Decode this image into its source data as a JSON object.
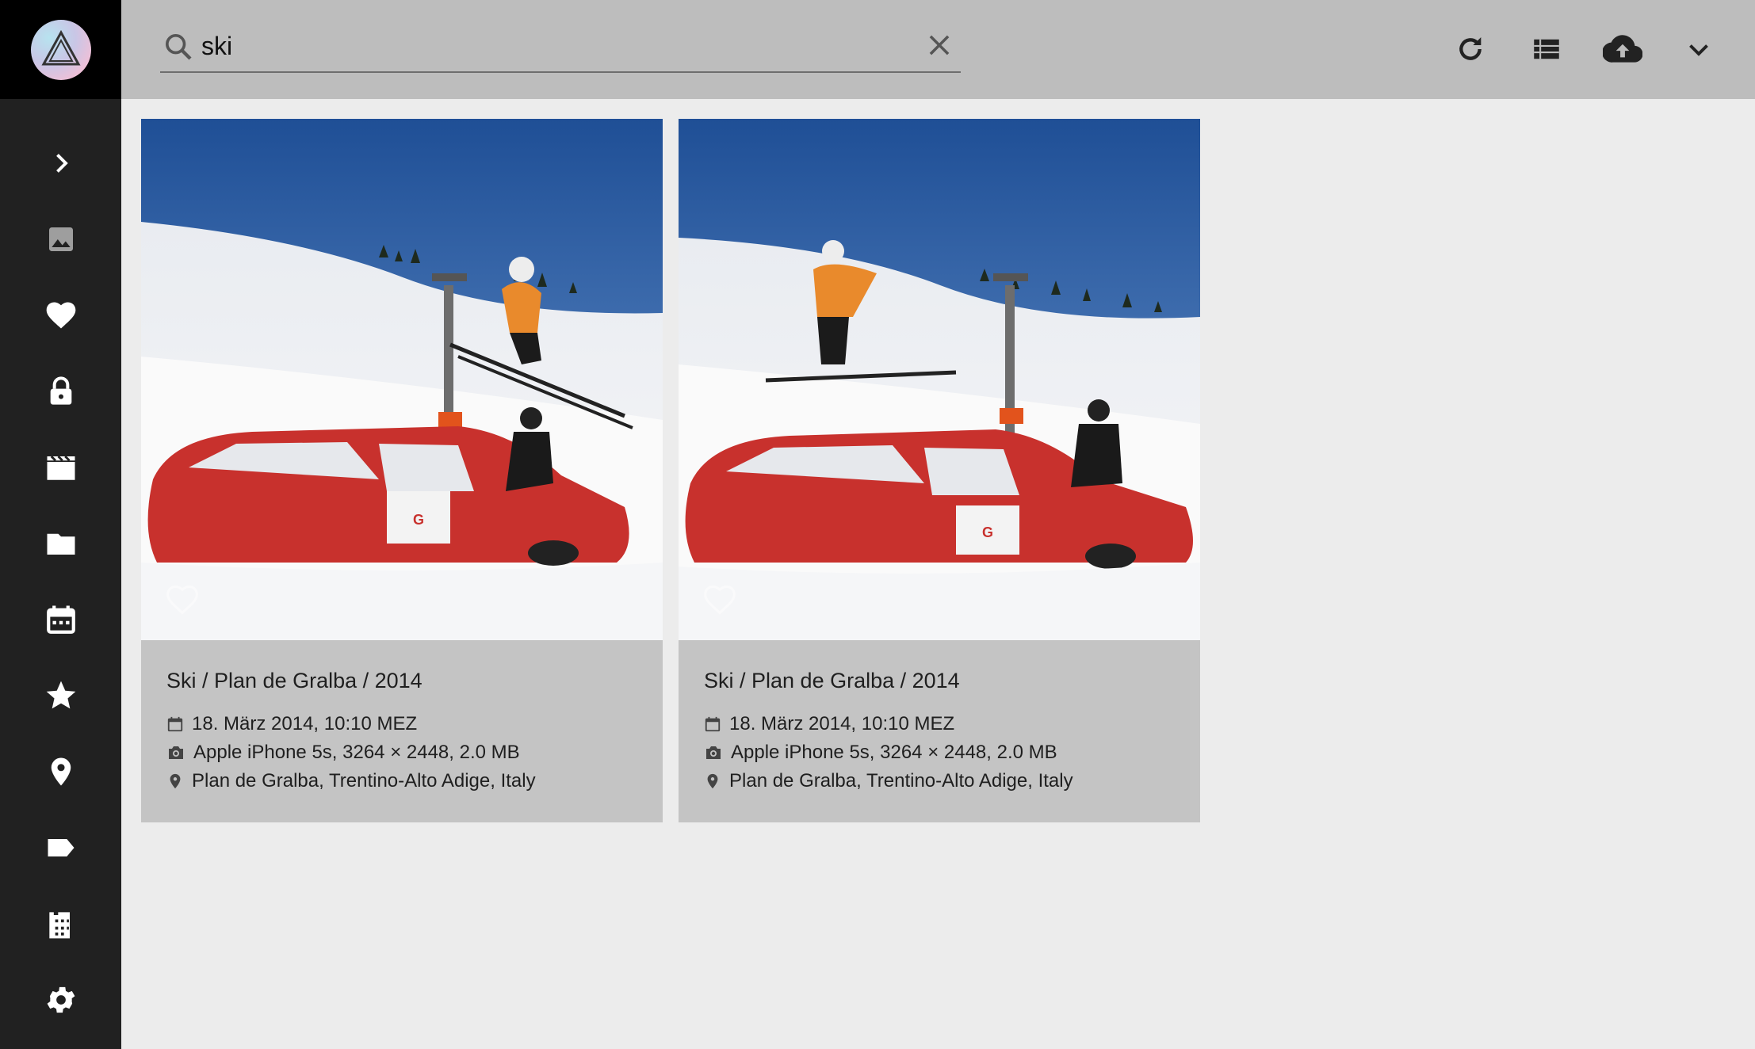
{
  "app": {
    "title": "PhotoPrism"
  },
  "search": {
    "value": "ski",
    "placeholder": "Search"
  },
  "toolbar": {
    "reload_icon": "refresh-icon",
    "view_icon": "view-list-icon",
    "upload_icon": "cloud-upload-icon",
    "expand_icon": "chevron-down-icon"
  },
  "sidebar": {
    "items": [
      {
        "name": "expand",
        "icon": "chevron-right-icon"
      },
      {
        "name": "photos",
        "icon": "image-icon"
      },
      {
        "name": "favorites",
        "icon": "heart-icon"
      },
      {
        "name": "private",
        "icon": "lock-icon"
      },
      {
        "name": "videos",
        "icon": "clapperboard-icon"
      },
      {
        "name": "folders",
        "icon": "folder-icon"
      },
      {
        "name": "calendar",
        "icon": "calendar-icon"
      },
      {
        "name": "moments",
        "icon": "star-icon"
      },
      {
        "name": "places",
        "icon": "map-marker-icon"
      },
      {
        "name": "labels",
        "icon": "label-icon"
      },
      {
        "name": "library",
        "icon": "film-archive-icon"
      },
      {
        "name": "settings",
        "icon": "gear-icon"
      }
    ]
  },
  "photos": [
    {
      "title": "Ski / Plan de Gralba / 2014",
      "date": "18. März 2014, 10:10 MEZ",
      "camera": "Apple iPhone 5s, 3264 × 2448, 2.0 MB",
      "location": "Plan de Gralba, Trentino-Alto Adige, Italy"
    },
    {
      "title": "Ski / Plan de Gralba / 2014",
      "date": "18. März 2014, 10:10 MEZ",
      "camera": "Apple iPhone 5s, 3264 × 2448, 2.0 MB",
      "location": "Plan de Gralba, Trentino-Alto Adige, Italy"
    }
  ],
  "colors": {
    "sidebar": "#212121",
    "topbar": "#bdbdbd",
    "card": "#c4c4c4",
    "background": "#ececec"
  }
}
